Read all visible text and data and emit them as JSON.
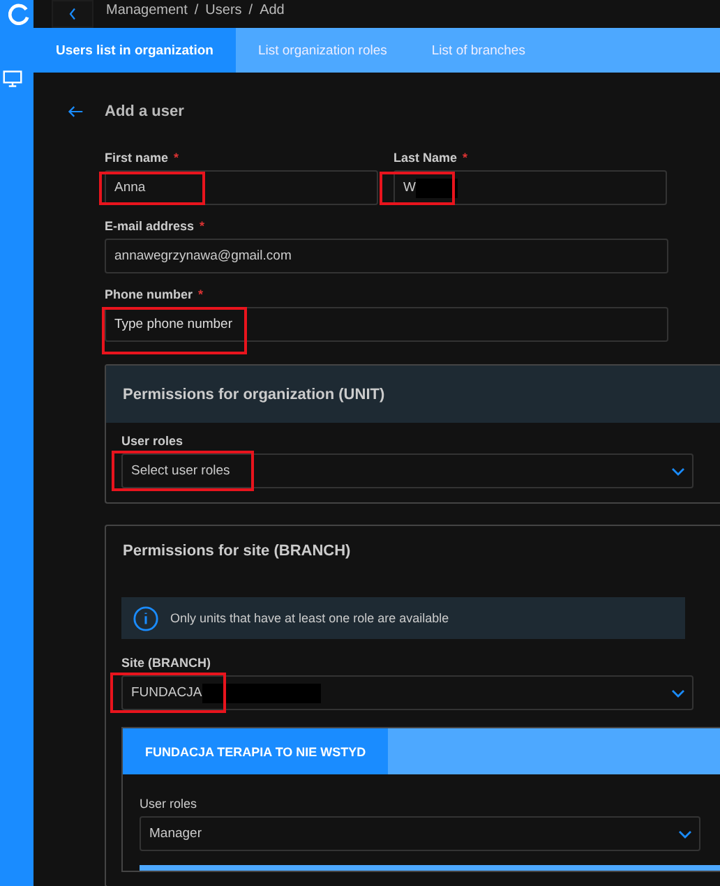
{
  "breadcrumb": [
    {
      "label": "Management",
      "link": true
    },
    {
      "separator": "/",
      "label": "Users",
      "link": true
    },
    {
      "separator": "/",
      "label": "Add"
    }
  ],
  "tabs": [
    {
      "label": "Users list in organization",
      "selected": true
    },
    {
      "label": "List organization roles",
      "selected": false
    },
    {
      "label": "List of branches",
      "selected": false
    }
  ],
  "page_title": "Add a user",
  "fields": [
    {
      "label": "First name",
      "required_mark": "*",
      "value": "Anna",
      "highlighted": true,
      "half": true
    },
    {
      "label": "Last Name",
      "required_mark": "*",
      "value": "W",
      "highlighted": true,
      "redacted": true,
      "half": true
    },
    {
      "label": "E-mail address",
      "required_mark": "*",
      "value": "annawegrzynawa@gmail.com"
    },
    {
      "label": "Phone number",
      "required_mark": "*",
      "placeholder": "Type phone number",
      "highlighted": true
    }
  ],
  "unit_panel": {
    "title": "Permissions for organization (UNIT)",
    "roles_label": "User roles",
    "roles_placeholder": "Select user roles",
    "highlighted": true
  },
  "branch_panel": {
    "title": "Permissions for site (BRANCH)",
    "info": "Only units that have at least one role are available",
    "site_label": "Site (BRANCH)",
    "site_value": "FUNDACJA",
    "site_redacted": true,
    "highlighted": true,
    "branch_tabs": [
      {
        "label": "FUNDACJA TERAPIA TO NIE WSTYD",
        "selected": true
      }
    ],
    "roles_label": "User roles",
    "roles_value": "Manager"
  }
}
